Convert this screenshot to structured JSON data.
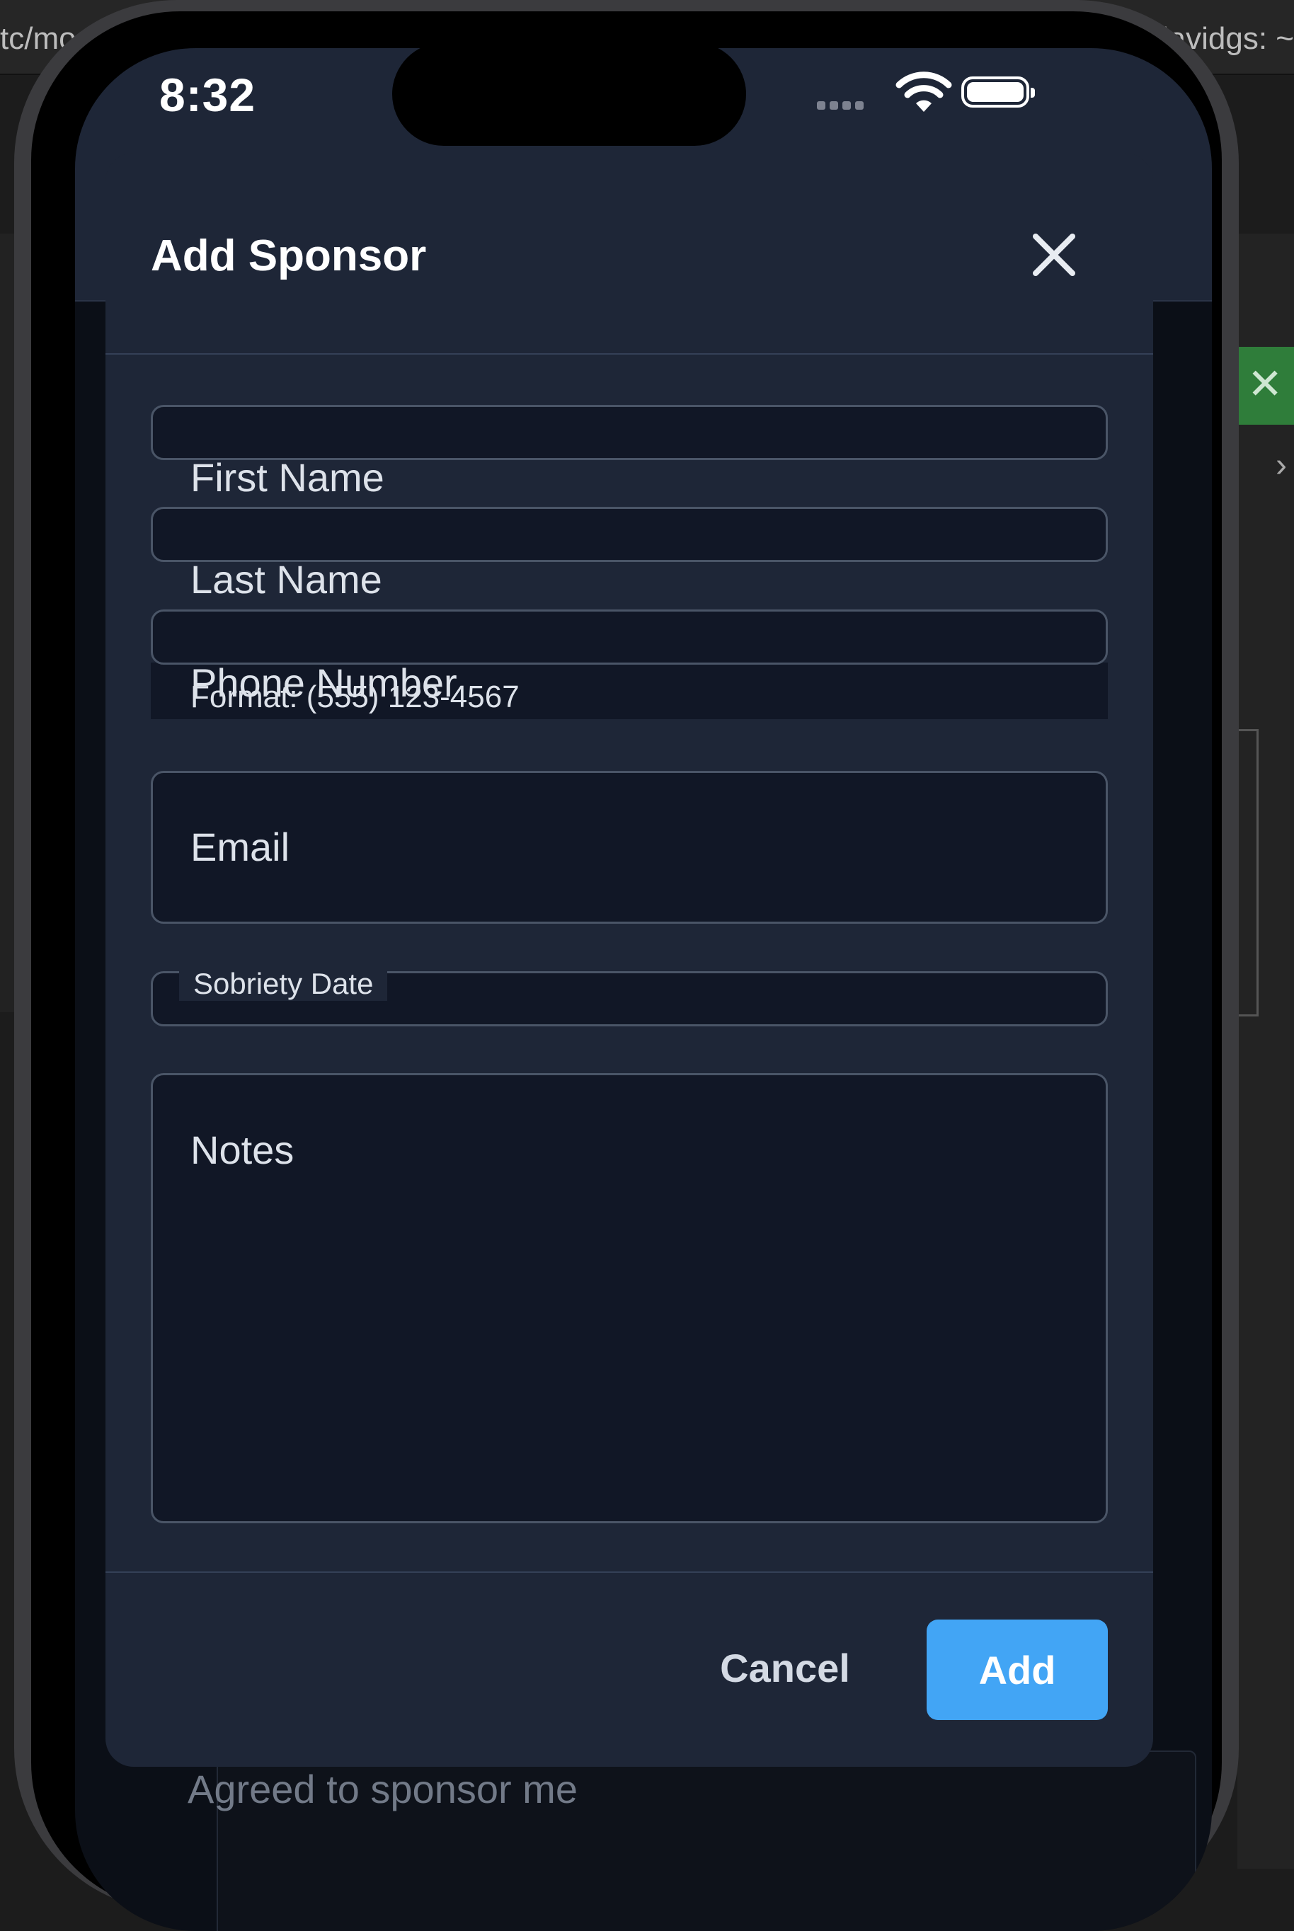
{
  "desktop": {
    "path_left": "tc/mos",
    "path_right": "davidgs: ~"
  },
  "status_bar": {
    "time": "8:32"
  },
  "background_list": {
    "visible_text": "Agreed to sponsor me"
  },
  "modal": {
    "title": "Add Sponsor",
    "fields": {
      "first_name": {
        "label": "First Name",
        "value": ""
      },
      "last_name": {
        "label": "Last Name",
        "value": ""
      },
      "phone": {
        "label": "Phone Number",
        "helper": "Format: (555) 123-4567",
        "value": ""
      },
      "email": {
        "label": "Email",
        "value": ""
      },
      "sobriety_date": {
        "label": "Sobriety Date",
        "value": ""
      },
      "notes": {
        "label": "Notes",
        "value": ""
      }
    },
    "actions": {
      "cancel_label": "Cancel",
      "add_label": "Add"
    }
  },
  "colors": {
    "modal_bg": "#1e2637",
    "field_bg": "#111726",
    "primary": "#42a5f5",
    "desktop_accent": "#2f7d3a"
  }
}
